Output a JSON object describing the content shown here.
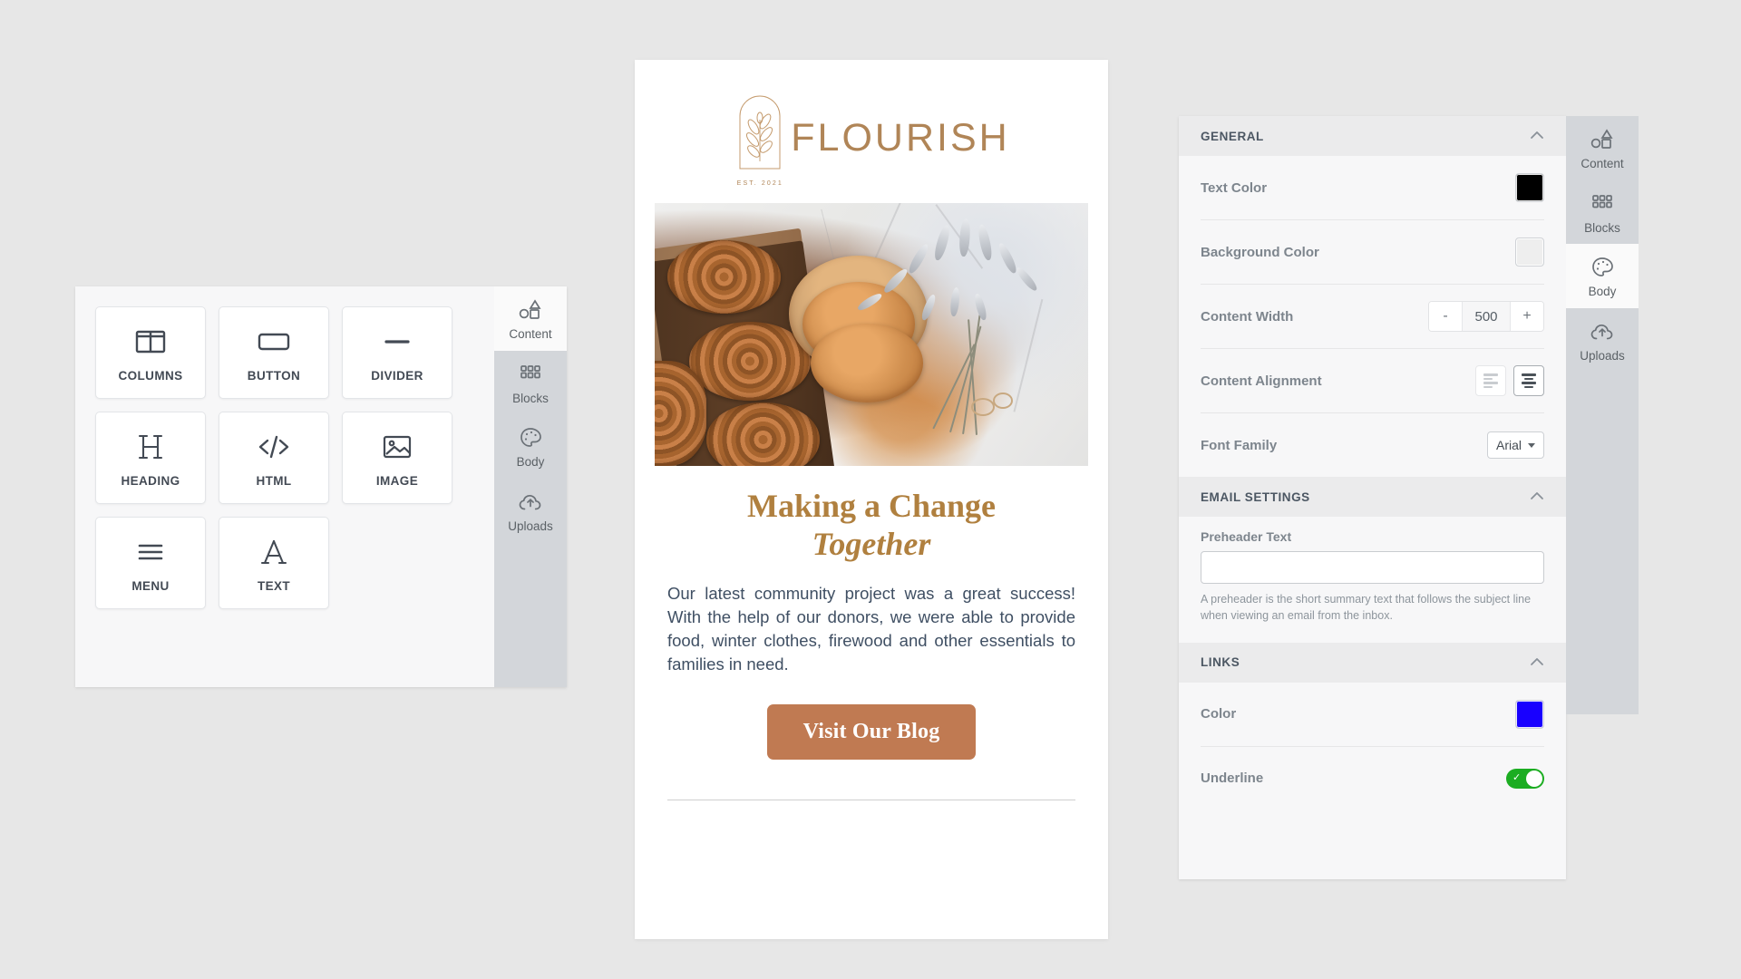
{
  "left_panel": {
    "tiles": [
      {
        "label": "COLUMNS",
        "icon": "columns-icon"
      },
      {
        "label": "BUTTON",
        "icon": "button-icon"
      },
      {
        "label": "DIVIDER",
        "icon": "divider-icon"
      },
      {
        "label": "HEADING",
        "icon": "heading-icon"
      },
      {
        "label": "HTML",
        "icon": "html-code-icon"
      },
      {
        "label": "IMAGE",
        "icon": "image-icon"
      },
      {
        "label": "MENU",
        "icon": "menu-icon"
      },
      {
        "label": "TEXT",
        "icon": "text-icon"
      }
    ],
    "rail": [
      {
        "label": "Content",
        "icon": "shapes-icon",
        "active": true
      },
      {
        "label": "Blocks",
        "icon": "grid-icon",
        "active": false
      },
      {
        "label": "Body",
        "icon": "palette-icon",
        "active": false
      },
      {
        "label": "Uploads",
        "icon": "cloud-upload-icon",
        "active": false
      }
    ]
  },
  "email": {
    "logo": {
      "word": "FLOURISH",
      "est": "EST. 2021",
      "color": "#b08557"
    },
    "hero_image_alt": "Cinnamon rolls in a wooden box with dried lavender on marble",
    "headline_line1": "Making a Change",
    "headline_line2": "Together",
    "headline_color": "#b0803f",
    "body": "Our latest community project was a great success! With the help of our donors, we were able to provide food, winter clothes, firewood and other essentials to families in need.",
    "body_color": "#3f4f63",
    "cta_label": "Visit Our Blog",
    "cta_color": "#c07a52"
  },
  "settings": {
    "sections": {
      "general": {
        "title": "GENERAL",
        "collapse_icon": "chevron-up-icon",
        "text_color": {
          "label": "Text Color",
          "value": "#000000"
        },
        "background_color": {
          "label": "Background Color",
          "value": "#eeeeee"
        },
        "content_width": {
          "label": "Content Width",
          "value": "500",
          "minus": "-",
          "plus": "+"
        },
        "content_alignment": {
          "label": "Content Alignment",
          "options": [
            "left",
            "center"
          ],
          "selected": "center"
        },
        "font_family": {
          "label": "Font Family",
          "value": "Arial"
        }
      },
      "email_settings": {
        "title": "EMAIL SETTINGS",
        "collapse_icon": "chevron-up-icon",
        "preheader": {
          "label": "Preheader Text",
          "value": "",
          "placeholder": "",
          "helper": "A preheader is the short summary text that follows the subject line when viewing an email from the inbox."
        }
      },
      "links": {
        "title": "LINKS",
        "collapse_icon": "chevron-up-icon",
        "color": {
          "label": "Color",
          "value": "#1800ff"
        },
        "underline": {
          "label": "Underline",
          "enabled": true,
          "on_color": "#1cad22"
        }
      }
    },
    "rail": [
      {
        "label": "Content",
        "icon": "shapes-icon",
        "active": false
      },
      {
        "label": "Blocks",
        "icon": "grid-icon",
        "active": false
      },
      {
        "label": "Body",
        "icon": "palette-icon",
        "active": true
      },
      {
        "label": "Uploads",
        "icon": "cloud-upload-icon",
        "active": false
      }
    ]
  }
}
